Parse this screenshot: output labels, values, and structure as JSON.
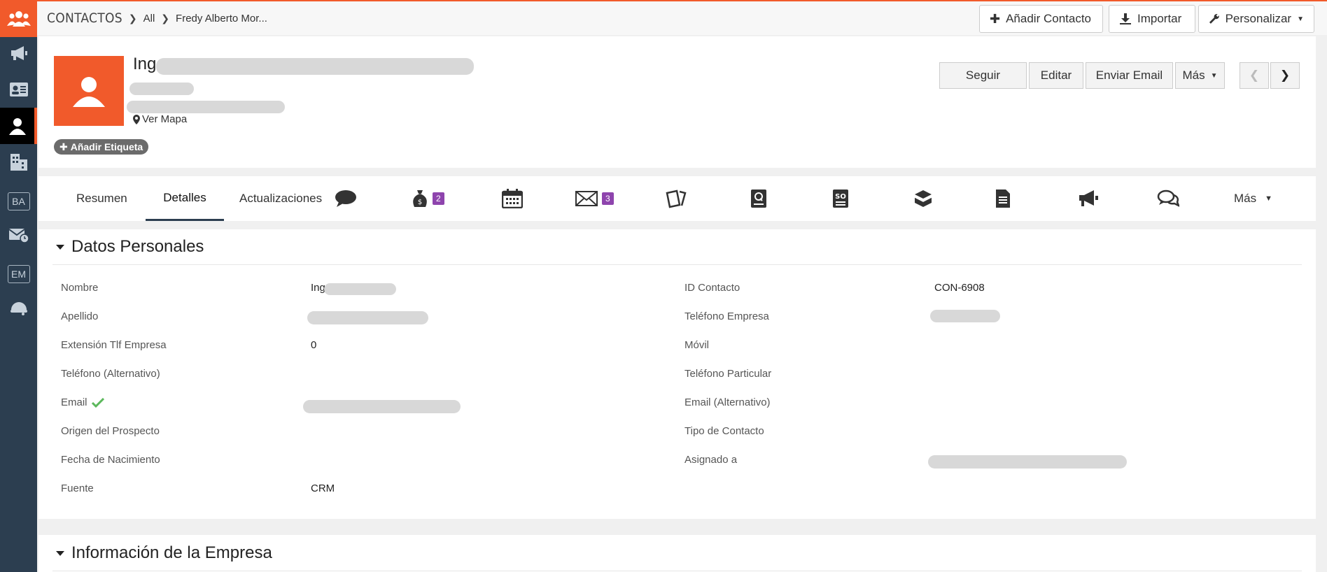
{
  "colors": {
    "accent": "#f15a2b",
    "sidebar": "#2c3e50",
    "badge": "#8e44ad",
    "check": "#5cb85c"
  },
  "sidebar": {
    "items": [
      {
        "name": "team-logo-icon"
      },
      {
        "name": "megaphone-icon"
      },
      {
        "name": "contact-card-icon"
      },
      {
        "name": "user-icon",
        "active": true
      },
      {
        "name": "building-icon"
      },
      {
        "name": "ba-icon",
        "text": "BA"
      },
      {
        "name": "email-clock-icon"
      },
      {
        "name": "em-icon",
        "text": "EM"
      },
      {
        "name": "helmet-icon"
      }
    ]
  },
  "topbar": {
    "module": "CONTACTOS",
    "crumb_all": "All",
    "crumb_record": "Fredy Alberto Mor...",
    "add_contact": "Añadir Contacto",
    "import": "Importar",
    "customize": "Personalizar"
  },
  "header": {
    "name_prefix": "Ing",
    "view_map": "Ver Mapa",
    "add_tag": "Añadir Etiqueta",
    "buttons": {
      "follow": "Seguir",
      "edit": "Editar",
      "send_email": "Enviar Email",
      "more": "Más"
    }
  },
  "tabs": {
    "summary": "Resumen",
    "details": "Detalles",
    "updates": "Actualizaciones",
    "more": "Más",
    "opportunities_count": "2",
    "emails_count": "3"
  },
  "personal": {
    "title": "Datos Personales",
    "first_name_label": "Nombre",
    "first_name_value": "Ing",
    "last_name_label": "Apellido",
    "ext_label": "Extensión Tlf Empresa",
    "ext_value": "0",
    "alt_phone_label": "Teléfono (Alternativo)",
    "email_label": "Email",
    "lead_source_label": "Origen del Prospecto",
    "birth_label": "Fecha de Nacimiento",
    "source_label": "Fuente",
    "source_value": "CRM",
    "contact_id_label": "ID Contacto",
    "contact_id_value": "CON-6908",
    "company_phone_label": "Teléfono Empresa",
    "mobile_label": "Móvil",
    "home_phone_label": "Teléfono Particular",
    "alt_email_label": "Email (Alternativo)",
    "contact_type_label": "Tipo de Contacto",
    "assigned_label": "Asignado a"
  },
  "company": {
    "title": "Información de la Empresa"
  }
}
